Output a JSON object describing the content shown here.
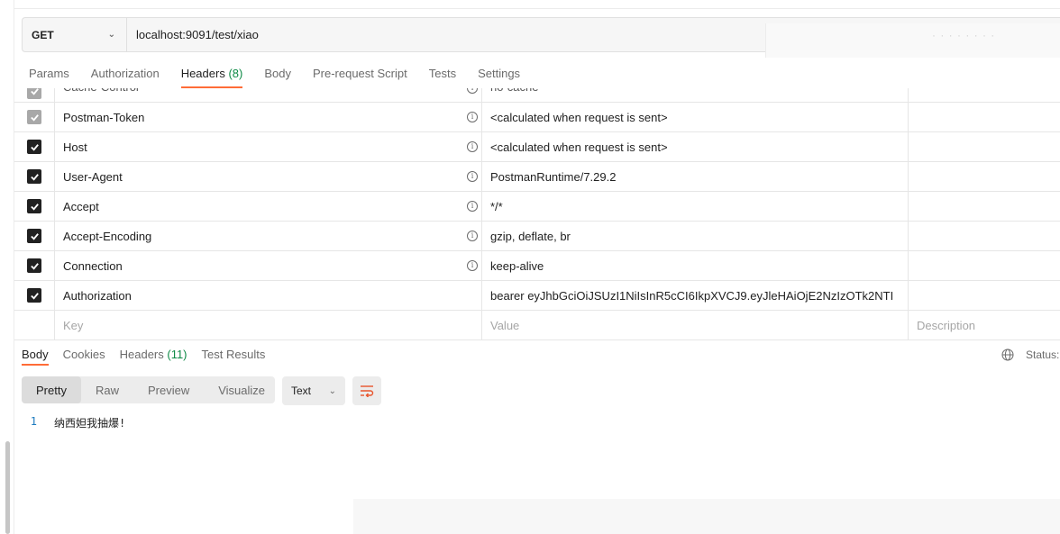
{
  "request": {
    "method": "GET",
    "url": "localhost:9091/test/xiao",
    "url_overlay_text": "· · · · · · · ·"
  },
  "request_tabs": [
    {
      "label": "Params",
      "count": ""
    },
    {
      "label": "Authorization",
      "count": ""
    },
    {
      "label": "Headers ",
      "count": "(8)"
    },
    {
      "label": "Body",
      "count": ""
    },
    {
      "label": "Pre-request Script",
      "count": ""
    },
    {
      "label": "Tests",
      "count": ""
    },
    {
      "label": "Settings",
      "count": ""
    }
  ],
  "headers_table": {
    "rows": [
      {
        "key": "Cache-Control",
        "value": "no-cache",
        "checked": true,
        "muted": true
      },
      {
        "key": "Postman-Token",
        "value": "<calculated when request is sent>",
        "checked": true,
        "muted": true
      },
      {
        "key": "Host",
        "value": "<calculated when request is sent>",
        "checked": true,
        "muted": false
      },
      {
        "key": "User-Agent",
        "value": "PostmanRuntime/7.29.2",
        "checked": true,
        "muted": false
      },
      {
        "key": "Accept",
        "value": "*/*",
        "checked": true,
        "muted": false
      },
      {
        "key": "Accept-Encoding",
        "value": "gzip, deflate, br",
        "checked": true,
        "muted": false
      },
      {
        "key": "Connection",
        "value": "keep-alive",
        "checked": true,
        "muted": false
      },
      {
        "key": "Authorization",
        "value": "bearer eyJhbGciOiJSUzI1NiIsInR5cCI6IkpXVCJ9.eyJleHAiOjE2NzIzOTk2NTI",
        "checked": true,
        "muted": false
      }
    ],
    "placeholders": {
      "key": "Key",
      "value": "Value",
      "description": "Description"
    }
  },
  "response_tabs": [
    {
      "label": "Body",
      "count": ""
    },
    {
      "label": "Cookies",
      "count": ""
    },
    {
      "label": "Headers ",
      "count": "(11)"
    },
    {
      "label": "Test Results",
      "count": ""
    }
  ],
  "status_label": "Status:",
  "view_modes": [
    "Pretty",
    "Raw",
    "Preview",
    "Visualize"
  ],
  "format": "Text",
  "body_lines": [
    {
      "num": "1",
      "text": "纳西妲我抽爆!"
    }
  ],
  "colors": {
    "accent": "#ff6c37",
    "count": "#0f8a46",
    "line_number": "#1d7bbf"
  },
  "icons": [
    "chevron-down-icon",
    "info-icon",
    "checkbox-check-icon",
    "globe-icon",
    "wrap-lines-icon"
  ]
}
